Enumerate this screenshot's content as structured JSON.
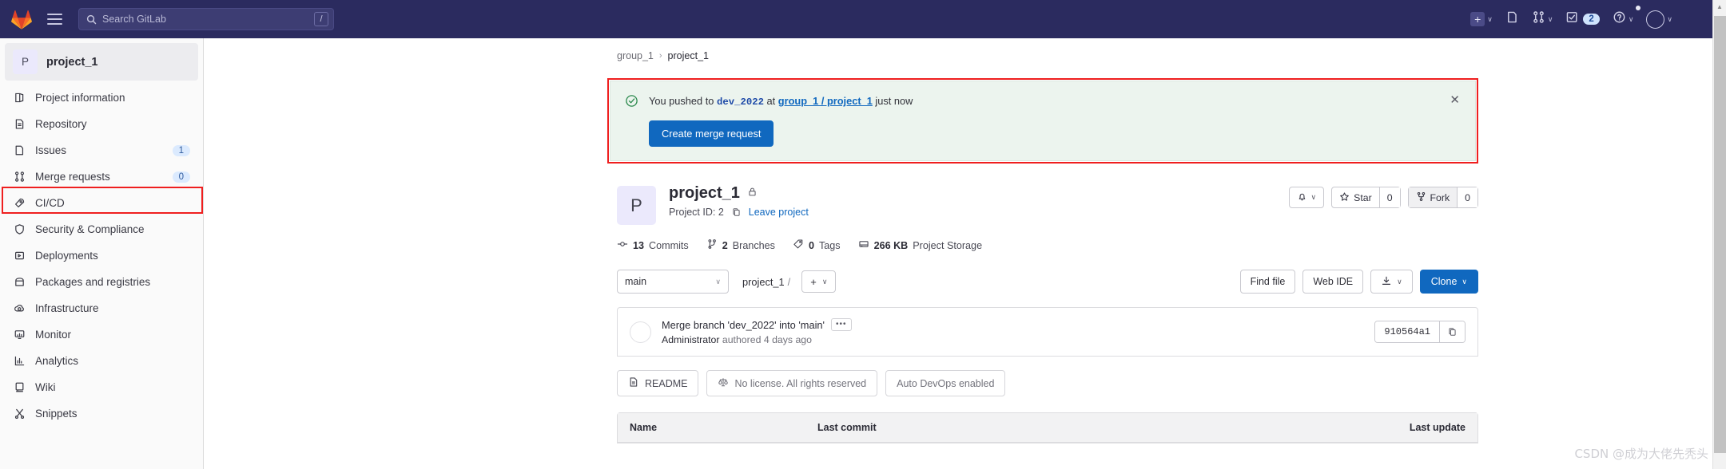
{
  "topbar": {
    "logo_icon": "gitlab-logo",
    "hamburger_icon": "hamburger-menu-icon",
    "search": {
      "placeholder": "Search GitLab",
      "value": "",
      "icon": "search-icon",
      "shortcut": "/"
    },
    "right_items": [
      {
        "name": "create-new",
        "icon": "plus-icon",
        "chevron": "∨"
      },
      {
        "name": "issues",
        "icon": "issues-icon"
      },
      {
        "name": "merge-requests",
        "icon": "merge-request-icon",
        "chevron": "∨"
      },
      {
        "name": "todos",
        "icon": "todo-check-icon",
        "badge": "2"
      },
      {
        "name": "help",
        "icon": "help-icon",
        "chevron": "∨"
      },
      {
        "name": "user-menu",
        "icon": "avatar-icon",
        "chevron": "∨"
      }
    ]
  },
  "sidebar": {
    "project": {
      "initial": "P",
      "name": "project_1"
    },
    "items": [
      {
        "label": "Project information",
        "icon": "project-info-icon",
        "count": null
      },
      {
        "label": "Repository",
        "icon": "repository-icon",
        "count": null
      },
      {
        "label": "Issues",
        "icon": "issues-icon",
        "count": "1"
      },
      {
        "label": "Merge requests",
        "icon": "merge-request-icon",
        "count": "0"
      },
      {
        "label": "CI/CD",
        "icon": "rocket-icon",
        "count": null
      },
      {
        "label": "Security & Compliance",
        "icon": "shield-icon",
        "count": null
      },
      {
        "label": "Deployments",
        "icon": "deployments-icon",
        "count": null
      },
      {
        "label": "Packages and registries",
        "icon": "package-icon",
        "count": null
      },
      {
        "label": "Infrastructure",
        "icon": "infrastructure-icon",
        "count": null
      },
      {
        "label": "Monitor",
        "icon": "monitor-icon",
        "count": null
      },
      {
        "label": "Analytics",
        "icon": "analytics-icon",
        "count": null
      },
      {
        "label": "Wiki",
        "icon": "wiki-icon",
        "count": null
      },
      {
        "label": "Snippets",
        "icon": "snippets-icon",
        "count": null
      }
    ]
  },
  "breadcrumb": {
    "group": "group_1",
    "separator": "›",
    "project": "project_1"
  },
  "alert": {
    "icon": "success-check-icon",
    "prefix": "You pushed to",
    "branch": "dev_2022",
    "at": "at",
    "target": "group_1 / project_1",
    "suffix": "just now",
    "button_label": "Create merge request",
    "close_icon": "close-icon"
  },
  "project_header": {
    "initial": "P",
    "title": "project_1",
    "visibility_icon": "lock-icon",
    "project_id_label": "Project ID: 2",
    "copy_icon": "copy-icon",
    "leave_label": "Leave project",
    "notification_icon": "bell-icon",
    "notification_chevron": "∨",
    "star": {
      "icon": "star-icon",
      "label": "Star",
      "count": "0"
    },
    "fork": {
      "icon": "fork-icon",
      "label": "Fork",
      "count": "0"
    }
  },
  "stats": [
    {
      "icon": "commit-icon",
      "value": "13",
      "label": "Commits"
    },
    {
      "icon": "branch-icon",
      "value": "2",
      "label": "Branches"
    },
    {
      "icon": "tag-icon",
      "value": "0",
      "label": "Tags"
    },
    {
      "icon": "storage-icon",
      "value": "266 KB",
      "label": "Project Storage"
    }
  ],
  "repo_bar": {
    "branch": "main",
    "branch_chevron": "∨",
    "path_project": "project_1",
    "path_separator": "/",
    "add_icon": "plus-icon",
    "add_chevron": "∨",
    "find_file": "Find file",
    "web_ide": "Web IDE",
    "download_icon": "download-icon",
    "download_chevron": "∨",
    "clone": "Clone",
    "clone_chevron": "∨"
  },
  "commit": {
    "avatar_icon": "avatar-icon",
    "title": "Merge branch 'dev_2022' into 'main'",
    "more_label": "•••",
    "author": "Administrator",
    "meta": "authored 4 days ago",
    "sha": "910564a1",
    "copy_icon": "copy-icon"
  },
  "badges": [
    {
      "label": "README",
      "icon": "readme-icon",
      "muted": false
    },
    {
      "label": "No license. All rights reserved",
      "icon": "license-scale-icon",
      "muted": true
    },
    {
      "label": "Auto DevOps enabled",
      "icon": null,
      "muted": true
    }
  ],
  "file_table": {
    "columns": [
      "Name",
      "Last commit",
      "Last update"
    ]
  },
  "watermark": "CSDN @成为大佬先秃头",
  "colors": {
    "topbar_bg": "#2b2b5f",
    "primary_blue": "#1068bf",
    "alert_bg": "#ecf4ee",
    "highlight_red": "#ef1f1f",
    "badge_blue": "#dbeafe"
  }
}
